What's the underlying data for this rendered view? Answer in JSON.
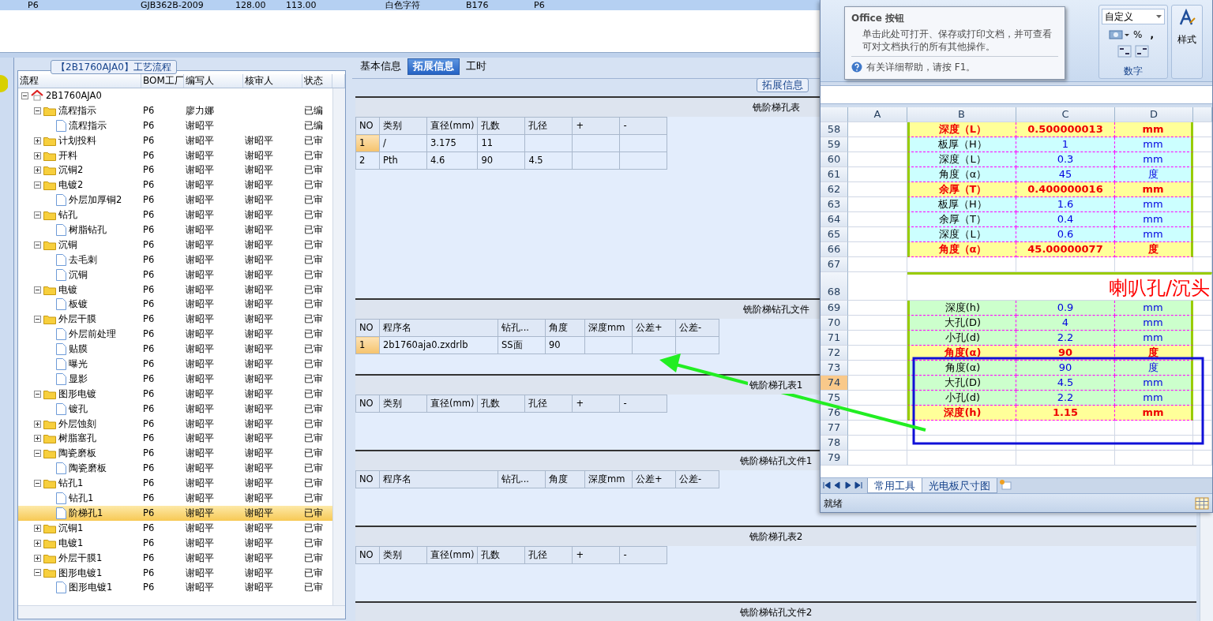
{
  "top_grid": {
    "rows": [
      {
        "selected": true,
        "cells": [
          "P6",
          "GJB362B-2009",
          "128.00",
          "113.00",
          "白色字符",
          "B176",
          "P6"
        ]
      }
    ]
  },
  "process_panel": {
    "title": "【2B1760AJA0】工艺流程",
    "columns": [
      "流程",
      "BOM工厂",
      "编写人",
      "核审人",
      "状态"
    ],
    "tree": [
      {
        "kind": "root",
        "label": "2B1760AJA0",
        "expanded": true,
        "selected": false,
        "children": [
          {
            "kind": "folder",
            "label": "流程指示",
            "factory": "P6",
            "writer": "廖力娜",
            "status": "已编",
            "expanded": true,
            "selected": false,
            "children": [
              {
                "kind": "doc",
                "label": "流程指示",
                "factory": "P6",
                "writer": "谢昭平",
                "status": "已编",
                "selected": false
              }
            ]
          },
          {
            "kind": "folder",
            "label": "计划投料",
            "factory": "P6",
            "writer": "谢昭平",
            "reviewer": "谢昭平",
            "status": "已审",
            "expanded": false,
            "selected": false
          },
          {
            "kind": "folder",
            "label": "开料",
            "factory": "P6",
            "writer": "谢昭平",
            "reviewer": "谢昭平",
            "status": "已审",
            "expanded": false,
            "selected": false
          },
          {
            "kind": "folder",
            "label": "沉铜2",
            "factory": "P6",
            "writer": "谢昭平",
            "reviewer": "谢昭平",
            "status": "已审",
            "expanded": false,
            "selected": false
          },
          {
            "kind": "folder",
            "label": "电镀2",
            "factory": "P6",
            "writer": "谢昭平",
            "reviewer": "谢昭平",
            "status": "已审",
            "expanded": true,
            "selected": false,
            "children": [
              {
                "kind": "doc",
                "label": "外层加厚铜2",
                "factory": "P6",
                "writer": "谢昭平",
                "reviewer": "谢昭平",
                "status": "已审",
                "selected": false
              }
            ]
          },
          {
            "kind": "folder",
            "label": "钻孔",
            "factory": "P6",
            "writer": "谢昭平",
            "reviewer": "谢昭平",
            "status": "已审",
            "expanded": true,
            "selected": false,
            "children": [
              {
                "kind": "doc",
                "label": "树脂钻孔",
                "factory": "P6",
                "writer": "谢昭平",
                "reviewer": "谢昭平",
                "status": "已审",
                "selected": false
              }
            ]
          },
          {
            "kind": "folder",
            "label": "沉铜",
            "factory": "P6",
            "writer": "谢昭平",
            "reviewer": "谢昭平",
            "status": "已审",
            "expanded": true,
            "selected": false,
            "children": [
              {
                "kind": "doc",
                "label": "去毛刺",
                "factory": "P6",
                "writer": "谢昭平",
                "reviewer": "谢昭平",
                "status": "已审",
                "selected": false
              },
              {
                "kind": "doc",
                "label": "沉铜",
                "factory": "P6",
                "writer": "谢昭平",
                "reviewer": "谢昭平",
                "status": "已审",
                "selected": false
              }
            ]
          },
          {
            "kind": "folder",
            "label": "电镀",
            "factory": "P6",
            "writer": "谢昭平",
            "reviewer": "谢昭平",
            "status": "已审",
            "expanded": true,
            "selected": false,
            "children": [
              {
                "kind": "doc",
                "label": "板镀",
                "factory": "P6",
                "writer": "谢昭平",
                "reviewer": "谢昭平",
                "status": "已审",
                "selected": false
              }
            ]
          },
          {
            "kind": "folder",
            "label": "外层干膜",
            "factory": "P6",
            "writer": "谢昭平",
            "reviewer": "谢昭平",
            "status": "已审",
            "expanded": true,
            "selected": false,
            "children": [
              {
                "kind": "doc",
                "label": "外层前处理",
                "factory": "P6",
                "writer": "谢昭平",
                "reviewer": "谢昭平",
                "status": "已审",
                "selected": false
              },
              {
                "kind": "doc",
                "label": "贴膜",
                "factory": "P6",
                "writer": "谢昭平",
                "reviewer": "谢昭平",
                "status": "已审",
                "selected": false
              },
              {
                "kind": "doc",
                "label": "曝光",
                "factory": "P6",
                "writer": "谢昭平",
                "reviewer": "谢昭平",
                "status": "已审",
                "selected": false
              },
              {
                "kind": "doc",
                "label": "显影",
                "factory": "P6",
                "writer": "谢昭平",
                "reviewer": "谢昭平",
                "status": "已审",
                "selected": false
              }
            ]
          },
          {
            "kind": "folder",
            "label": "图形电镀",
            "factory": "P6",
            "writer": "谢昭平",
            "reviewer": "谢昭平",
            "status": "已审",
            "expanded": true,
            "selected": false,
            "children": [
              {
                "kind": "doc",
                "label": "镀孔",
                "factory": "P6",
                "writer": "谢昭平",
                "reviewer": "谢昭平",
                "status": "已审",
                "selected": false
              }
            ]
          },
          {
            "kind": "folder",
            "label": "外层蚀刻",
            "factory": "P6",
            "writer": "谢昭平",
            "reviewer": "谢昭平",
            "status": "已审",
            "expanded": false,
            "selected": false
          },
          {
            "kind": "folder",
            "label": "树脂塞孔",
            "factory": "P6",
            "writer": "谢昭平",
            "reviewer": "谢昭平",
            "status": "已审",
            "expanded": false,
            "selected": false
          },
          {
            "kind": "folder",
            "label": "陶瓷磨板",
            "factory": "P6",
            "writer": "谢昭平",
            "reviewer": "谢昭平",
            "status": "已审",
            "expanded": true,
            "selected": false,
            "children": [
              {
                "kind": "doc",
                "label": "陶瓷磨板",
                "factory": "P6",
                "writer": "谢昭平",
                "reviewer": "谢昭平",
                "status": "已审",
                "selected": false
              }
            ]
          },
          {
            "kind": "folder",
            "label": "钻孔1",
            "factory": "P6",
            "writer": "谢昭平",
            "reviewer": "谢昭平",
            "status": "已审",
            "expanded": true,
            "selected": false,
            "children": [
              {
                "kind": "doc",
                "label": "钻孔1",
                "factory": "P6",
                "writer": "谢昭平",
                "reviewer": "谢昭平",
                "status": "已审",
                "selected": false
              },
              {
                "kind": "doc",
                "label": "阶梯孔1",
                "factory": "P6",
                "writer": "谢昭平",
                "reviewer": "谢昭平",
                "status": "已审",
                "selected": true
              }
            ]
          },
          {
            "kind": "folder",
            "label": "沉铜1",
            "factory": "P6",
            "writer": "谢昭平",
            "reviewer": "谢昭平",
            "status": "已审",
            "expanded": false,
            "selected": false
          },
          {
            "kind": "folder",
            "label": "电镀1",
            "factory": "P6",
            "writer": "谢昭平",
            "reviewer": "谢昭平",
            "status": "已审",
            "expanded": false,
            "selected": false
          },
          {
            "kind": "folder",
            "label": "外层干膜1",
            "factory": "P6",
            "writer": "谢昭平",
            "reviewer": "谢昭平",
            "status": "已审",
            "expanded": false,
            "selected": false
          },
          {
            "kind": "folder",
            "label": "图形电镀1",
            "factory": "P6",
            "writer": "谢昭平",
            "reviewer": "谢昭平",
            "status": "已审",
            "expanded": true,
            "selected": false,
            "children": [
              {
                "kind": "doc",
                "label": "图形电镀1",
                "factory": "P6",
                "writer": "谢昭平",
                "reviewer": "谢昭平",
                "status": "已审",
                "selected": false
              }
            ]
          }
        ]
      }
    ]
  },
  "detail_panel": {
    "tabs": [
      {
        "label": "基本信息",
        "selected": false
      },
      {
        "label": "拓展信息",
        "selected": true
      },
      {
        "label": "工时",
        "selected": false
      }
    ],
    "group_title": "拓展信息",
    "sections": [
      {
        "title": "铣阶梯孔表",
        "kind": "holes",
        "columns": [
          "NO",
          "类别",
          "直径(mm)",
          "孔数",
          "孔径",
          "+",
          "-"
        ],
        "rows": [
          {
            "selected": true,
            "no": "1",
            "category": "/",
            "diameter": "3.175",
            "count": "11"
          },
          {
            "selected": false,
            "no": "2",
            "category": "Pth",
            "diameter": "4.6",
            "count": "90",
            "hole_size": "4.5"
          }
        ]
      },
      {
        "title": "铣阶梯钻孔文件",
        "kind": "files",
        "columns": [
          "NO",
          "程序名",
          "钻孔...",
          "角度",
          "深度mm",
          "公差+",
          "公差-"
        ],
        "rows": [
          {
            "selected": true,
            "no": "1",
            "program": "2b1760aja0.zxdrlb",
            "drill_side": "SS面",
            "angle": "90"
          }
        ]
      },
      {
        "title": "铣阶梯孔表1",
        "kind": "holes",
        "columns": [
          "NO",
          "类别",
          "直径(mm)",
          "孔数",
          "孔径",
          "+",
          "-"
        ]
      },
      {
        "title": "铣阶梯钻孔文件1",
        "kind": "files",
        "columns": [
          "NO",
          "程序名",
          "钻孔...",
          "角度",
          "深度mm",
          "公差+",
          "公差-"
        ]
      },
      {
        "title": "铣阶梯孔表2",
        "kind": "holes",
        "columns": [
          "NO",
          "类别",
          "直径(mm)",
          "孔数",
          "孔径",
          "+",
          "-"
        ]
      },
      {
        "title": "铣阶梯钻孔文件2",
        "kind": "files"
      }
    ]
  },
  "excel": {
    "tooltip": {
      "title": "Office 按钮",
      "text": "单击此处可打开、保存或打印文档，并可查看可对文档执行的所有其他操作。",
      "help": "有关详细帮助，请按 F1。"
    },
    "number_format": "自定义",
    "percent": "%",
    "comma": ",",
    "number_group": "数字",
    "styles_button": "样式",
    "column_headers": [
      "A",
      "B",
      "C",
      "D"
    ],
    "rows": [
      {
        "number": "58",
        "kind": "result",
        "label": "深度（L）",
        "value": "0.500000013",
        "unit": "mm",
        "selected": false
      },
      {
        "number": "59",
        "kind": "cyan",
        "label": "板厚（H）",
        "value": "1",
        "unit": "mm",
        "selected": false
      },
      {
        "number": "60",
        "kind": "cyan",
        "label": "深度（L）",
        "value": "0.3",
        "unit": "mm",
        "selected": false
      },
      {
        "number": "61",
        "kind": "cyan",
        "label": "角度（α）",
        "value": "45",
        "unit": "度",
        "selected": false
      },
      {
        "number": "62",
        "kind": "result",
        "label": "余厚（T）",
        "value": "0.400000016",
        "unit": "mm",
        "selected": false
      },
      {
        "number": "63",
        "kind": "cyan",
        "label": "板厚（H）",
        "value": "1.6",
        "unit": "mm",
        "selected": false
      },
      {
        "number": "64",
        "kind": "cyan",
        "label": "余厚（T）",
        "value": "0.4",
        "unit": "mm",
        "selected": false
      },
      {
        "number": "65",
        "kind": "cyan",
        "label": "深度（L）",
        "value": "0.6",
        "unit": "mm",
        "selected": false
      },
      {
        "number": "66",
        "kind": "result",
        "label": "角度（α）",
        "value": "45.00000077",
        "unit": "度",
        "selected": false
      },
      {
        "number": "67",
        "kind": "blank",
        "selected": false
      },
      {
        "number": "68",
        "kind": "title",
        "label": "喇叭孔/沉头",
        "selected": false
      },
      {
        "number": "69",
        "kind": "green",
        "label": "深度(h)",
        "value": "0.9",
        "unit": "mm",
        "selected": false
      },
      {
        "number": "70",
        "kind": "green",
        "label": "大孔(D)",
        "value": "4",
        "unit": "mm",
        "selected": false
      },
      {
        "number": "71",
        "kind": "green",
        "label": "小孔(d)",
        "value": "2.2",
        "unit": "mm",
        "selected": false
      },
      {
        "number": "72",
        "kind": "result",
        "label": "角度(α)",
        "value": "90",
        "unit": "度",
        "selected": false
      },
      {
        "number": "73",
        "kind": "green",
        "label": "角度(α)",
        "value": "90",
        "unit": "度",
        "selected": false
      },
      {
        "number": "74",
        "kind": "green",
        "label": "大孔(D)",
        "value": "4.5",
        "unit": "mm",
        "selected": true
      },
      {
        "number": "75",
        "kind": "green",
        "label": "小孔(d)",
        "value": "2.2",
        "unit": "mm",
        "selected": false
      },
      {
        "number": "76",
        "kind": "result",
        "label": "深度(h)",
        "value": "1.15",
        "unit": "mm",
        "selected": false
      },
      {
        "number": "77",
        "kind": "blank",
        "selected": false
      },
      {
        "number": "78",
        "kind": "blank",
        "selected": false
      },
      {
        "number": "79",
        "kind": "blank",
        "selected": false
      }
    ],
    "sheet_tabs": [
      {
        "label": "常用工具",
        "selected": true
      },
      {
        "label": "光电板尺寸图",
        "selected": false
      }
    ],
    "status": "就绪"
  }
}
